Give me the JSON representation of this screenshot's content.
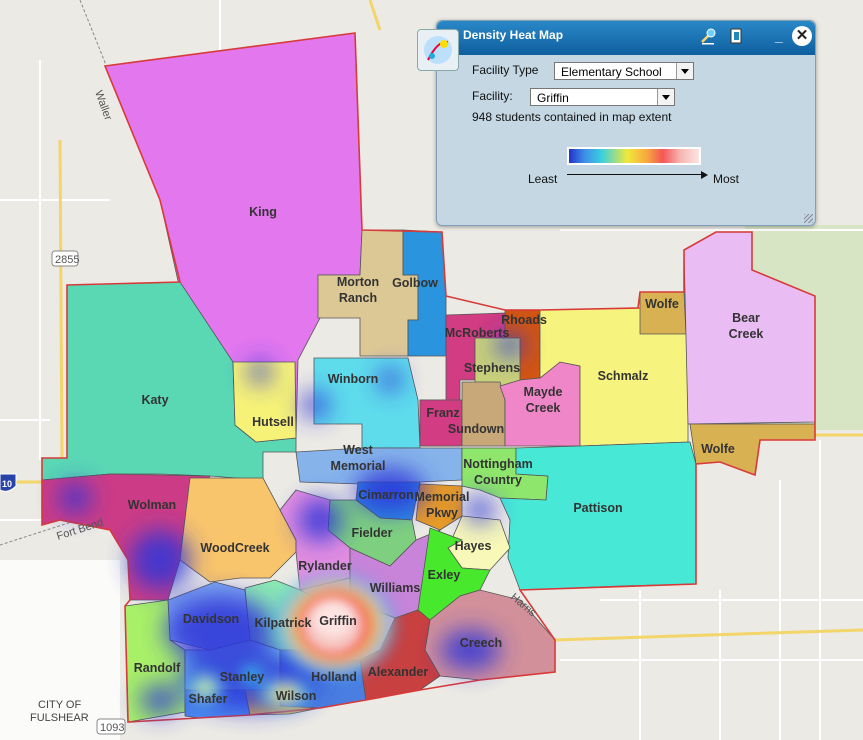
{
  "map": {
    "zones": [
      {
        "name": "King",
        "color": "#e277ee"
      },
      {
        "name": "Morton\nRanch",
        "color": "#dcc895"
      },
      {
        "name": "Golbow",
        "color": "#2a94de"
      },
      {
        "name": "Katy",
        "color": "#5ad8b4"
      },
      {
        "name": "Hutsell",
        "color": "#f6f278"
      },
      {
        "name": "Winborn",
        "color": "#5fdcec"
      },
      {
        "name": "McRoberts",
        "color": "#d23c82"
      },
      {
        "name": "Rhoads",
        "color": "#d25512"
      },
      {
        "name": "Stephens",
        "color": "#c8d07a"
      },
      {
        "name": "Franz",
        "color": "#d23c82"
      },
      {
        "name": "Sundown",
        "color": "#c8a878"
      },
      {
        "name": "Mayde\nCreek",
        "color": "#ee86c8"
      },
      {
        "name": "Schmalz",
        "color": "#f6f47e"
      },
      {
        "name": "Wolfe",
        "color": "#d8b252"
      },
      {
        "name": "Bear\nCreek",
        "color": "#eabcf4"
      },
      {
        "name": "West\nMemorial",
        "color": "#86b4ea"
      },
      {
        "name": "Nottingham\nCountry",
        "color": "#8ee66c"
      },
      {
        "name": "Pattison",
        "color": "#48e8d6"
      },
      {
        "name": "Wolman",
        "color": "#cc3c86"
      },
      {
        "name": "WoodCreek",
        "color": "#f8c46c"
      },
      {
        "name": "Cimarron",
        "color": "#2c8ae0"
      },
      {
        "name": "Memorial\nPkwy",
        "color": "#e69a28"
      },
      {
        "name": "Fielder",
        "color": "#7ed080"
      },
      {
        "name": "Hayes",
        "color": "#f8f8b8"
      },
      {
        "name": "Rylander",
        "color": "#e48ee0"
      },
      {
        "name": "Williams",
        "color": "#c884d8"
      },
      {
        "name": "Exley",
        "color": "#48e82c"
      },
      {
        "name": "Davidson",
        "color": "#7ea8f0"
      },
      {
        "name": "Kilpatrick",
        "color": "#8ce8b4"
      },
      {
        "name": "Griffin",
        "color": "#f0a8c8"
      },
      {
        "name": "Creech",
        "color": "#d2909a"
      },
      {
        "name": "Randolf",
        "color": "#a8f068"
      },
      {
        "name": "Stanley",
        "color": "#80d8f0"
      },
      {
        "name": "Holland",
        "color": "#4a7ee0"
      },
      {
        "name": "Alexander",
        "color": "#c84040"
      },
      {
        "name": "Shafer",
        "color": "#4c8cf0"
      },
      {
        "name": "Wilson",
        "color": "#e6b44a"
      }
    ],
    "road_labels": {
      "waller": "Waller",
      "fort_bend": "Fort Bend",
      "harris": "Harris",
      "hwy_2855": "2855",
      "hwy_1093": "1093",
      "i10": "10",
      "city": "CITY OF",
      "city2": "FULSHEAR"
    }
  },
  "panel": {
    "title": "Density Heat Map",
    "facility_type_label": "Facility Type",
    "facility_type_value": "Elementary School",
    "facility_label": "Facility:",
    "facility_value": "Griffin",
    "count_text": "948 students contained in map extent",
    "legend_least": "Least",
    "legend_most": "Most",
    "close_symbol": "✕",
    "minimize_symbol": "_"
  },
  "colors": {
    "header": "#1a74b8",
    "panel_bg": "#bed4e2",
    "district_border": "#d83a3a"
  }
}
